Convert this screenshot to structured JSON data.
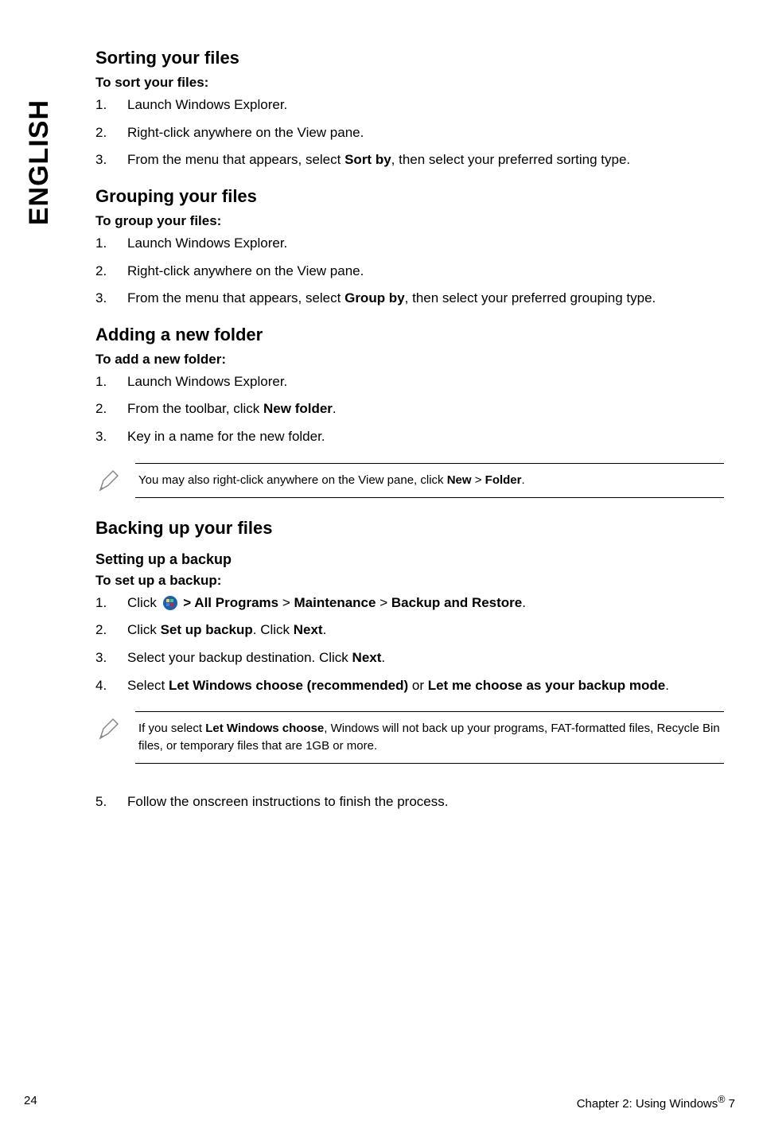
{
  "side_tab": "ENGLISH",
  "sections": {
    "sorting": {
      "title": "Sorting your files",
      "sub": "To sort your files:",
      "items": [
        {
          "n": "1.",
          "t": "Launch Windows Explorer."
        },
        {
          "n": "2.",
          "t": "Right-click anywhere on the View pane."
        },
        {
          "n": "3.",
          "t_pre": "From the menu that appears, select ",
          "t_bold": "Sort by",
          "t_post": ", then select your preferred sorting type."
        }
      ]
    },
    "grouping": {
      "title": "Grouping your files",
      "sub": "To group your files:",
      "items": [
        {
          "n": "1.",
          "t": "Launch Windows Explorer."
        },
        {
          "n": "2.",
          "t": "Right-click anywhere on the View pane."
        },
        {
          "n": "3.",
          "t_pre": "From the menu that appears, select ",
          "t_bold": "Group by",
          "t_post": ", then select your preferred grouping type."
        }
      ]
    },
    "adding": {
      "title": "Adding a new folder",
      "sub": "To add a new folder:",
      "items": [
        {
          "n": "1.",
          "t": "Launch Windows Explorer."
        },
        {
          "n": "2.",
          "t_pre": "From the toolbar, click ",
          "t_bold": "New folder",
          "t_post": "."
        },
        {
          "n": "3.",
          "t": "Key in a name for the new folder."
        }
      ],
      "note_pre": "You may also right-click anywhere on the View pane, click ",
      "note_bold1": "New",
      "note_mid": " > ",
      "note_bold2": "Folder",
      "note_post": "."
    },
    "backing": {
      "title": "Backing up your files",
      "setting_title": "Setting up a backup",
      "sub": "To set up a backup:",
      "items": {
        "i1": {
          "n": "1.",
          "pre": "Click ",
          "b1": " > All Programs",
          "gt1": " > ",
          "b2": "Maintenance",
          "gt2": " > ",
          "b3": "Backup and Restore",
          "post": "."
        },
        "i2": {
          "n": "2.",
          "pre": "Click ",
          "b1": "Set up backup",
          "mid": ". Click ",
          "b2": "Next",
          "post": "."
        },
        "i3": {
          "n": "3.",
          "pre": "Select your backup destination. Click ",
          "b1": "Next",
          "post": "."
        },
        "i4": {
          "n": "4.",
          "pre": "Select ",
          "b1": "Let Windows choose (recommended)",
          "mid": " or ",
          "b2": "Let me choose as your backup mode",
          "post": "."
        }
      },
      "note_pre": "If you select ",
      "note_bold": "Let Windows choose",
      "note_post": ", Windows will not back up your programs, FAT-formatted files, Recycle Bin files, or temporary files that are 1GB or more.",
      "item5": {
        "n": "5.",
        "t": "Follow the onscreen instructions to finish the process."
      }
    }
  },
  "footer": {
    "page": "24",
    "chapter_pre": "Chapter 2: Using Windows",
    "reg": "®",
    "chapter_post": " 7"
  }
}
